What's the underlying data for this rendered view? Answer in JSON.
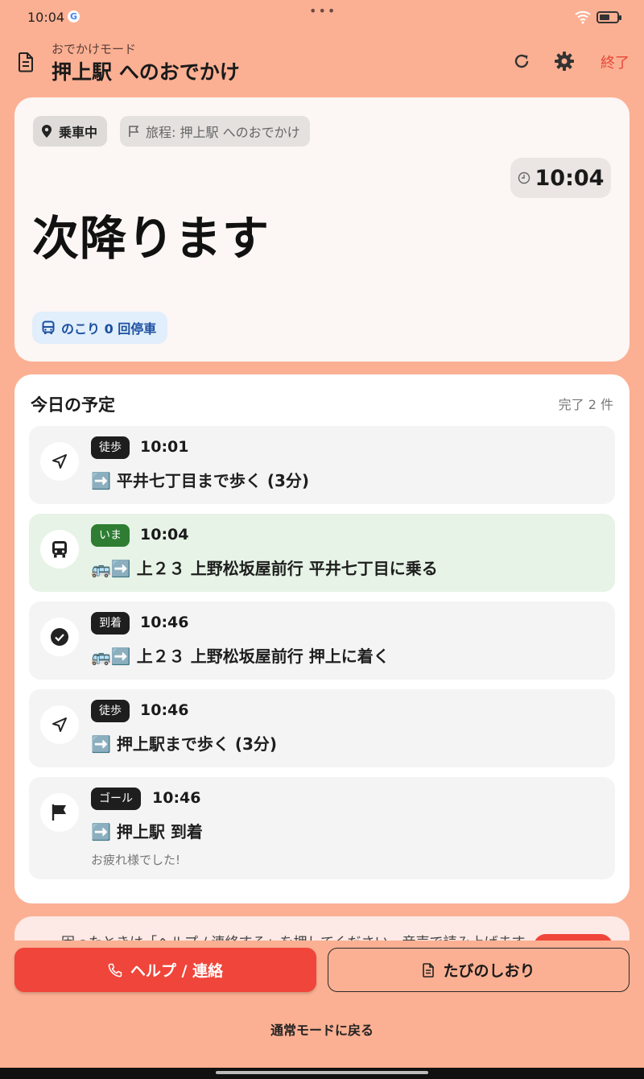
{
  "status_bar": {
    "time": "10:04",
    "google_badge": "G"
  },
  "app_bar": {
    "subtitle": "おでかけモード",
    "title": "押上駅 へのおでかけ",
    "end_label": "終了"
  },
  "status_card": {
    "riding_chip": "乗車中",
    "trip_chip": "旅程: 押上駅 へのおでかけ",
    "clock": "10:04",
    "message": "次降ります",
    "remaining_stops": "のこり 0 回停車"
  },
  "schedule": {
    "title": "今日の予定",
    "done_count": "完了 2 件",
    "steps": [
      {
        "badge": "徒歩",
        "time": "10:01",
        "desc": "➡️ 平井七丁目まで歩く (3分)",
        "icon": "navigation-arrow-icon"
      },
      {
        "badge": "いま",
        "time": "10:04",
        "desc": "🚌➡️ 上２３ 上野松坂屋前行 平井七丁目に乗る",
        "icon": "bus-icon"
      },
      {
        "badge": "到着",
        "time": "10:46",
        "desc": "🚌➡️ 上２３ 上野松坂屋前行 押上に着く",
        "icon": "check-circle-icon"
      },
      {
        "badge": "徒歩",
        "time": "10:46",
        "desc": "➡️ 押上駅まで歩く (3分)",
        "icon": "navigation-arrow-icon"
      },
      {
        "badge": "ゴール",
        "time": "10:46",
        "desc": "➡️ 押上駅 到着",
        "note": "お疲れ様でした!",
        "icon": "flag-icon"
      }
    ]
  },
  "info_banner": {
    "text": "困ったときは「ヘルプ / 連絡する」を押してください。音声で読み上げます"
  },
  "buttons": {
    "help": "ヘルプ / 連絡",
    "guide": "たびのしおり",
    "back": "通常モードに戻る"
  },
  "colors": {
    "background": "#fbb093",
    "accent_red": "#f0453a",
    "current_step": "#e6f3e6",
    "now_badge": "#2e7d32"
  }
}
